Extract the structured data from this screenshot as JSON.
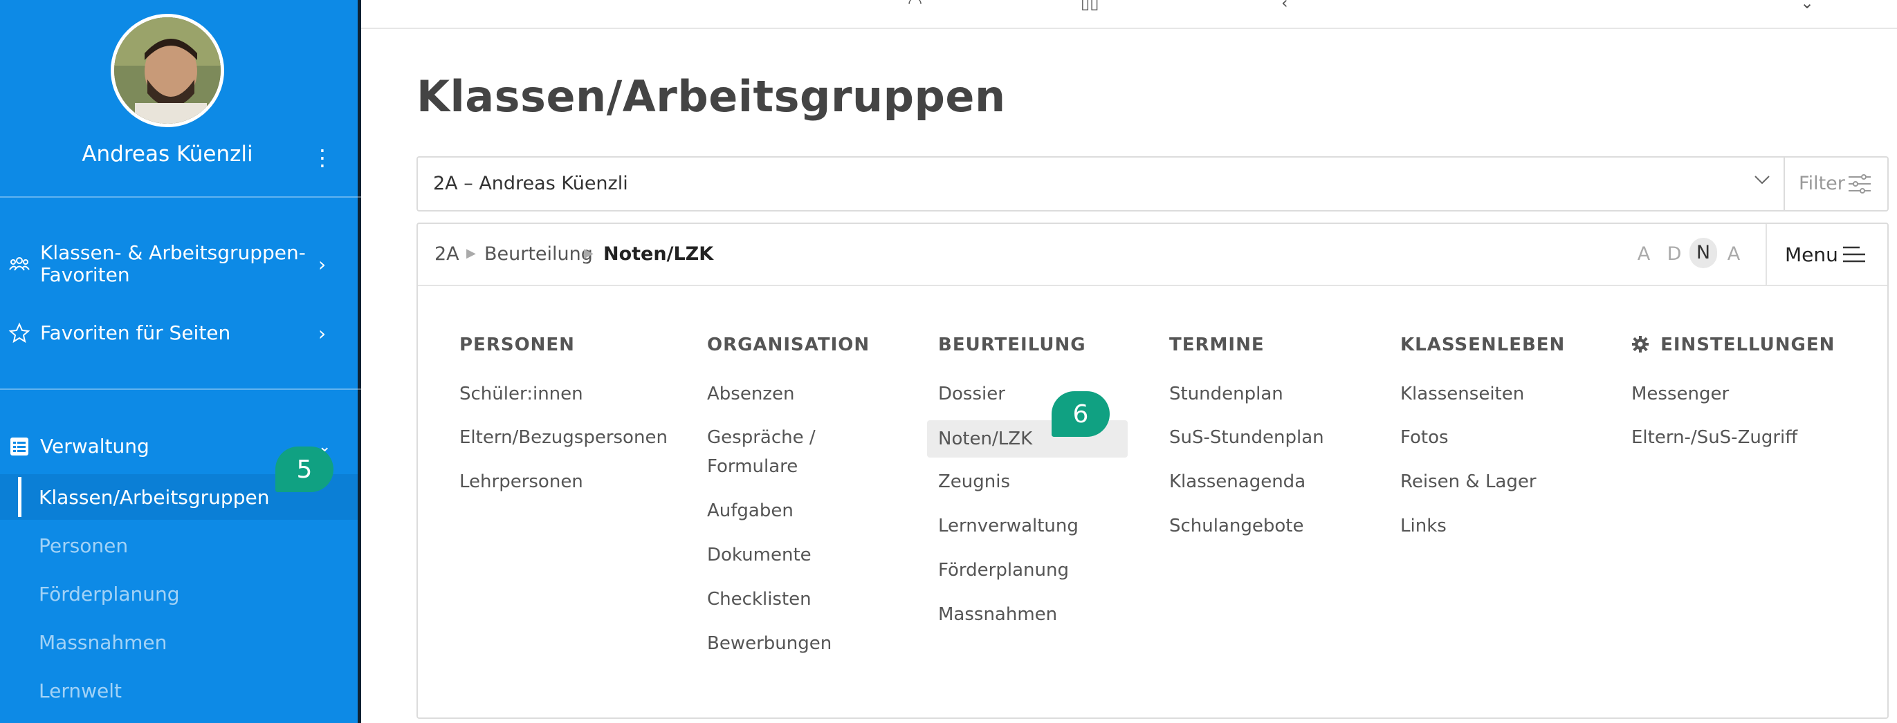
{
  "sidebar": {
    "user_name": "Andreas Küenzli",
    "favorites_group": "Klassen- & Arbeitsgruppen-Favoriten",
    "favorites_group_line1": "Klassen- & Arbeitsgruppen-",
    "favorites_group_line2": "Favoriten",
    "favorites_pages": "Favoriten für Seiten",
    "admin": "Verwaltung",
    "admin_items": [
      "Klassen/Arbeitsgruppen",
      "Personen",
      "Förderplanung",
      "Massnahmen",
      "Lernwelt"
    ]
  },
  "badges": {
    "step5": "5",
    "step6": "6"
  },
  "main": {
    "title": "Klassen/Arbeitsgruppen",
    "select_value": "2A – Andreas Küenzli",
    "filter_label": "Filter",
    "breadcrumb": [
      "2A",
      "Beurteilung",
      "Noten/LZK"
    ],
    "view_letters": [
      "A",
      "D",
      "N",
      "A"
    ],
    "menu_label": "Menu"
  },
  "menu_columns": [
    {
      "header": "PERSONEN",
      "items": [
        "Schüler:innen",
        "Eltern/Bezugspersonen",
        "Lehrpersonen"
      ]
    },
    {
      "header": "ORGANISATION",
      "items": [
        "Absenzen",
        "Gespräche /",
        "Formulare",
        "Aufgaben",
        "Dokumente",
        "Checklisten",
        "Bewerbungen"
      ]
    },
    {
      "header": "BEURTEILUNG",
      "items": [
        "Dossier",
        "Noten/LZK",
        "Zeugnis",
        "Lernverwaltung",
        "Förderplanung",
        "Massnahmen"
      ]
    },
    {
      "header": "TERMINE",
      "items": [
        "Stundenplan",
        "SuS-Stundenplan",
        "Klassenagenda",
        "Schulangebote"
      ]
    },
    {
      "header": "KLASSENLEBEN",
      "items": [
        "Klassenseiten",
        "Fotos",
        "Reisen & Lager",
        "Links"
      ]
    },
    {
      "header": "EINSTELLUNGEN",
      "items": [
        "Messenger",
        "Eltern-/SuS-Zugriff"
      ]
    }
  ],
  "colors": {
    "sidebar": "#0d8ae6",
    "badge": "#10a182",
    "active": "#0b7fd6"
  }
}
